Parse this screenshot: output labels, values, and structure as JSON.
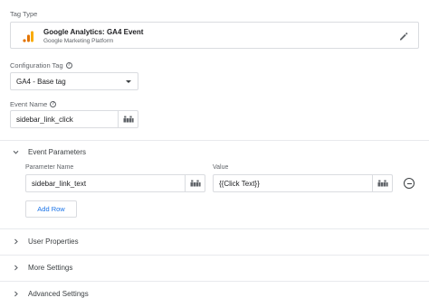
{
  "tag_type": {
    "label": "Tag Type",
    "title": "Google Analytics: GA4 Event",
    "subtitle": "Google Marketing Platform",
    "icon": "ga-bars-icon",
    "edit_icon": "pencil-icon"
  },
  "configuration_tag": {
    "label": "Configuration Tag",
    "help_icon": "?",
    "value": "GA4 - Base tag"
  },
  "event_name": {
    "label": "Event Name",
    "help_icon": "?",
    "value": "sidebar_link_click"
  },
  "event_parameters": {
    "title": "Event Parameters",
    "expanded": true,
    "columns": [
      "Parameter Name",
      "Value"
    ],
    "rows": [
      {
        "name": "sidebar_link_text",
        "value": "{{Click Text}}"
      }
    ],
    "add_row_label": "Add Row"
  },
  "sections": [
    {
      "title": "User Properties",
      "expanded": false
    },
    {
      "title": "More Settings",
      "expanded": false
    },
    {
      "title": "Advanced Settings",
      "expanded": false
    }
  ],
  "colors": {
    "accent_blue": "#1a73e8",
    "ga_orange": "#f9ab00",
    "ga_dark_orange": "#e37400",
    "border": "#dadce0"
  }
}
